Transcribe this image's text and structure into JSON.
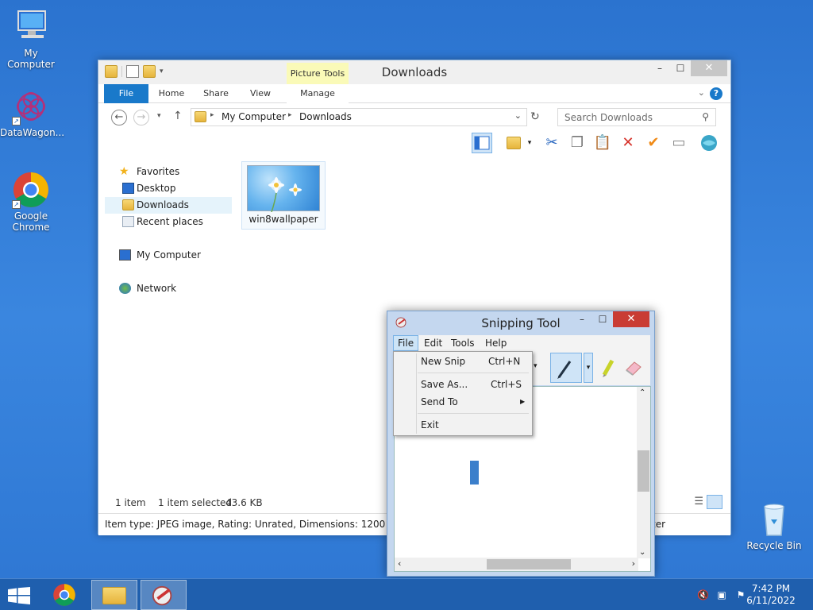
{
  "desktop": {
    "icons": [
      {
        "label": "My Computer"
      },
      {
        "label": "DataWagon..."
      },
      {
        "label": "Google Chrome"
      },
      {
        "label": "Recycle Bin"
      }
    ]
  },
  "explorer": {
    "title": "Downloads",
    "contextual_tab_group": "Picture Tools",
    "tabs": [
      {
        "label": "File"
      },
      {
        "label": "Home"
      },
      {
        "label": "Share"
      },
      {
        "label": "View"
      },
      {
        "label": "Manage"
      }
    ],
    "address": {
      "segments": [
        "My Computer",
        "Downloads"
      ]
    },
    "search": {
      "placeholder": "Search Downloads"
    },
    "nav_pane": {
      "favorites": "Favorites",
      "favorite_items": [
        "Desktop",
        "Downloads",
        "Recent places"
      ],
      "my_computer": "My Computer",
      "network": "Network"
    },
    "files": [
      {
        "name": "win8wallpaper"
      }
    ],
    "status": {
      "count": "1 item",
      "selected": "1 item selected",
      "size": "43.6 KB"
    },
    "details": "Item type: JPEG image, Rating: Unrated, Dimensions: 1200 x 800, Size",
    "details_tail": "ter"
  },
  "snipping_tool": {
    "title": "Snipping Tool",
    "menu": [
      "File",
      "Edit",
      "Tools",
      "Help"
    ],
    "file_menu": [
      {
        "label": "New Snip",
        "shortcut": "Ctrl+N"
      },
      {
        "label": "Save As...",
        "shortcut": "Ctrl+S"
      },
      {
        "label": "Send To",
        "shortcut": ""
      },
      {
        "label": "Exit",
        "shortcut": ""
      }
    ]
  },
  "taskbar": {
    "time": "7:42 PM",
    "date": "6/11/2022"
  },
  "colors": {
    "accent": "#1979ca",
    "desktop": "#2f77d2",
    "taskbar": "#1f5fae",
    "close_red": "#c93c34"
  }
}
